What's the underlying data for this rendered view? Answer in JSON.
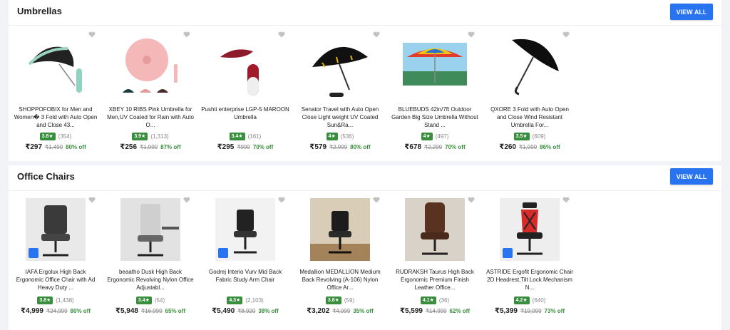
{
  "sections": [
    {
      "title": "Umbrellas",
      "view_all": "VIEW ALL",
      "items": [
        {
          "title": "SHOPPOFOBIX for Men and Women� 3 Fold with Auto Open and Close 43...",
          "rating": "3.8★",
          "count": "(354)",
          "price": "₹297",
          "mrp": "₹1,499",
          "off": "80% off",
          "icon": "umbrella-icon"
        },
        {
          "title": "XBEY 10 RIBS Pink Umbrella for Men,UV Coated for Rain with Auto O...",
          "rating": "3.9★",
          "count": "(1,313)",
          "price": "₹256",
          "mrp": "₹1,999",
          "off": "87% off",
          "icon": "umbrella-icon"
        },
        {
          "title": "Pushti enterprise LGP-5 MAROON Umbrella",
          "rating": "3.4★",
          "count": "(161)",
          "price": "₹295",
          "mrp": "₹999",
          "off": "70% off",
          "icon": "umbrella-icon"
        },
        {
          "title": "Senator Travel with Auto Open Close Light weight UV Coated Sun&Ra...",
          "rating": "4★",
          "count": "(536)",
          "price": "₹579",
          "mrp": "₹2,999",
          "off": "80% off",
          "icon": "umbrella-icon"
        },
        {
          "title": "BLUEBUDS 42in/7ft Outdoor Garden Big Size Umbrella Without Stand ...",
          "rating": "4★",
          "count": "(497)",
          "price": "₹678",
          "mrp": "₹2,299",
          "off": "70% off",
          "icon": "umbrella-icon"
        },
        {
          "title": "QXORE 3 Fold with Auto Open and Close Wind Resistant Umbrella For...",
          "rating": "3.5★",
          "count": "(609)",
          "price": "₹260",
          "mrp": "₹1,999",
          "off": "86% off",
          "icon": "umbrella-icon"
        }
      ]
    },
    {
      "title": "Office Chairs",
      "view_all": "VIEW ALL",
      "items": [
        {
          "title": "IAFA Ergolux High Back Ergonomic Office Chair with Ad Heavy Duty ...",
          "rating": "3.8★",
          "count": "(1,438)",
          "price": "₹4,999",
          "mrp": "₹24,999",
          "off": "80% off",
          "icon": "chair-icon"
        },
        {
          "title": "beaatho Dusk High Back Ergonomic Revolving Nylon Office Adjustabl...",
          "rating": "3.4★",
          "count": "(54)",
          "price": "₹5,948",
          "mrp": "₹16,999",
          "off": "65% off",
          "icon": "chair-icon"
        },
        {
          "title": "Godrej Interio Vurv Mid Back Fabric Study Arm Chair",
          "rating": "4.3★",
          "count": "(2,103)",
          "price": "₹5,490",
          "mrp": "₹8,920",
          "off": "38% off",
          "icon": "chair-icon"
        },
        {
          "title": "Medallion MEDALLION Medium Back Revolving (A-106) Nylon Office Ar...",
          "rating": "3.8★",
          "count": "(59)",
          "price": "₹3,202",
          "mrp": "₹4,999",
          "off": "35% off",
          "icon": "chair-icon"
        },
        {
          "title": "RUDRAKSH Taurus High Back Ergonomic Premium Finish Leather Office...",
          "rating": "4.1★",
          "count": "(36)",
          "price": "₹5,599",
          "mrp": "₹14,999",
          "off": "62% off",
          "icon": "chair-icon"
        },
        {
          "title": "ASTRIDE Ergofit Ergonomic Chair 2D Headrest,Tilt Lock Mechanism N...",
          "rating": "4.2★",
          "count": "(640)",
          "price": "₹5,399",
          "mrp": "₹19,999",
          "off": "73% off",
          "icon": "chair-icon"
        }
      ]
    }
  ],
  "colors": {
    "accent": "#2874f0",
    "rating_badge": "#388e3c",
    "discount": "#388e3c",
    "muted": "#878787"
  }
}
